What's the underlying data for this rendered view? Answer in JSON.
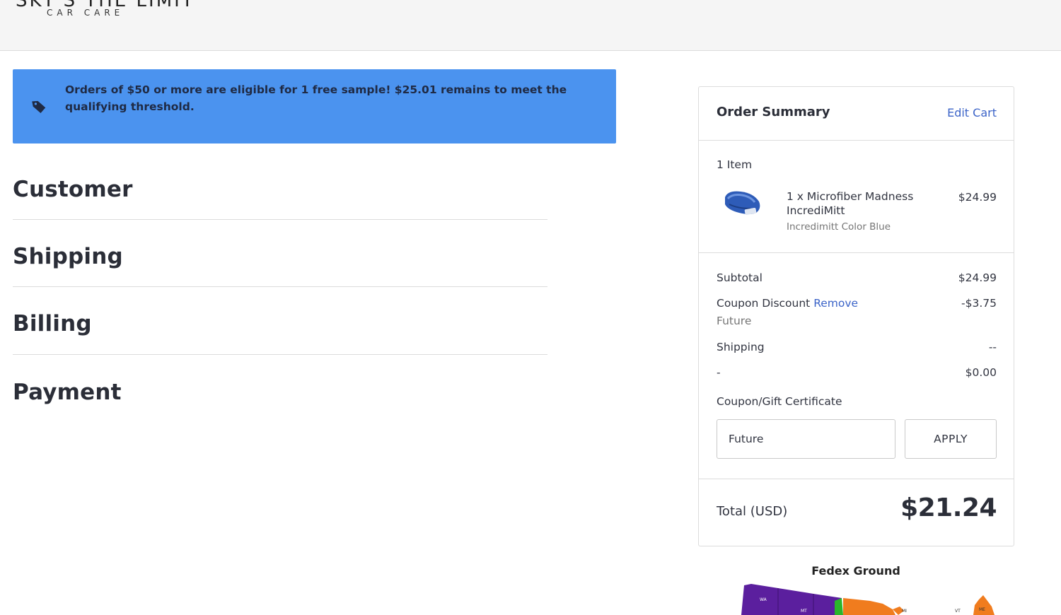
{
  "header": {
    "logo_main": "SKY'S THE LIMIT",
    "logo_sub": "CAR CARE"
  },
  "banner": {
    "icon": "tag-icon",
    "text": "Orders of $50 or more are eligible for 1 free sample! $25.01 remains to meet the qualifying threshold."
  },
  "sections": {
    "customer": "Customer",
    "shipping": "Shipping",
    "billing": "Billing",
    "payment": "Payment"
  },
  "summary": {
    "title": "Order Summary",
    "edit_cart": "Edit Cart",
    "item_count": "1 Item",
    "items": [
      {
        "name": "1 x Microfiber Madness IncrediMitt",
        "variant": "Incredimitt Color Blue",
        "price": "$24.99"
      }
    ],
    "subtotal_label": "Subtotal",
    "subtotal_value": "$24.99",
    "coupon_label": "Coupon Discount",
    "coupon_remove": "Remove",
    "coupon_code": "Future",
    "coupon_value": "-$3.75",
    "shipping_label": "Shipping",
    "shipping_value": "--",
    "dash_label": "-",
    "dash_value": "$0.00",
    "coupon_field_label": "Coupon/Gift Certificate",
    "coupon_input_value": "Future",
    "apply_label": "APPLY",
    "total_label": "Total (USD)",
    "total_value": "$21.24"
  },
  "shipping_map": {
    "title": "Fedex Ground",
    "labels": [
      "WA",
      "MT",
      "MI",
      "VT",
      "ME"
    ]
  },
  "colors": {
    "banner": "#4b93ef",
    "link": "#3c64c8",
    "map_purple": "#5b1f9e",
    "map_orange": "#f07c1e",
    "map_green": "#2bb52b"
  }
}
